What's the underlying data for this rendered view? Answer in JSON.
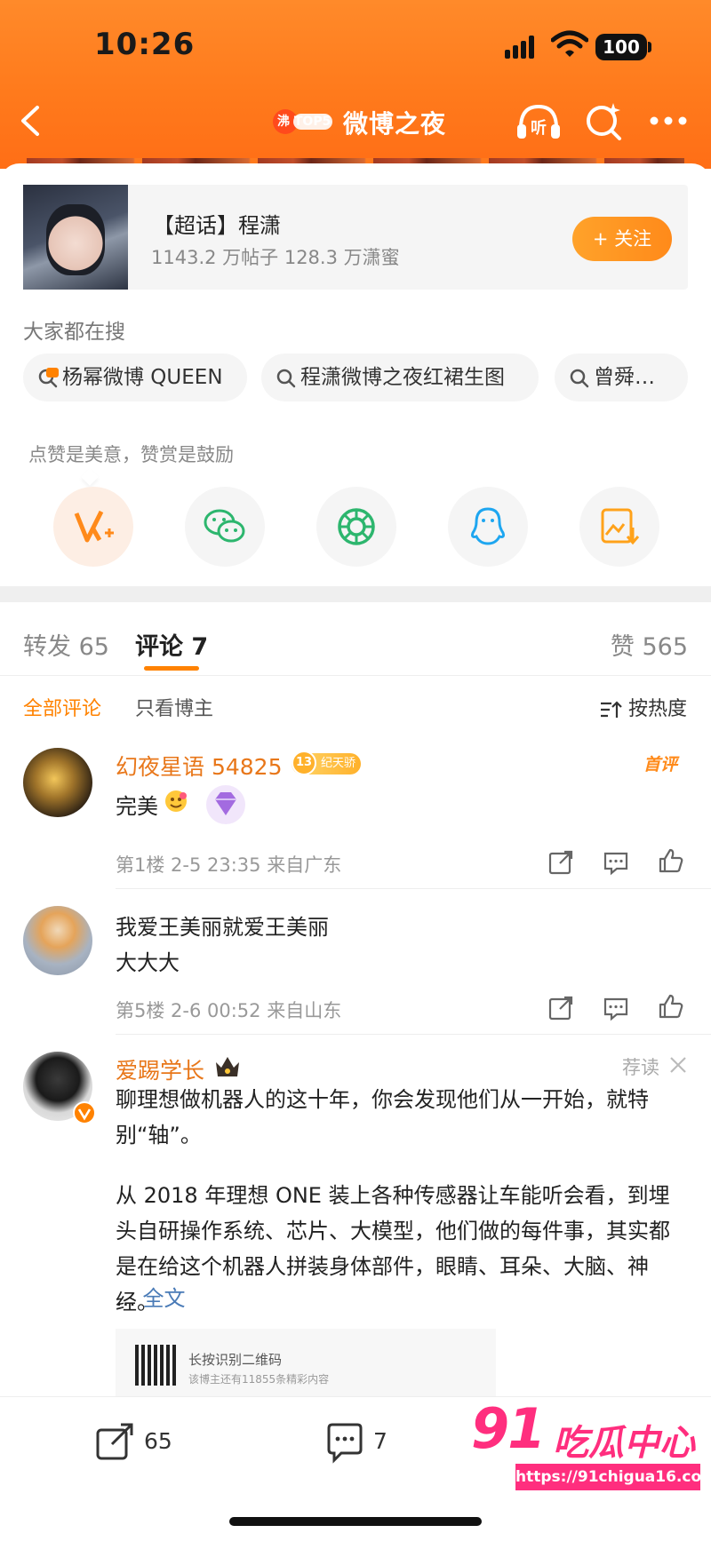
{
  "status_bar": {
    "time": "10:26",
    "battery": "100"
  },
  "nav": {
    "brand_badge": "沸 TOP5",
    "title": "微博之夜"
  },
  "topic": {
    "name": "【超话】程潇",
    "stats": "1143.2 万帖子 128.3 万潇蜜",
    "follow_label": "+ 关注"
  },
  "search": {
    "heading": "大家都在搜",
    "chips": [
      {
        "label": "杨幂微博 QUEEN",
        "icon": "hot-icon"
      },
      {
        "label": "程潇微博之夜红裙生图",
        "icon": "search-icon"
      },
      {
        "label": "曾舜…",
        "icon": "search-icon"
      }
    ]
  },
  "reward_tip": "点赞是美意，赞赏是鼓励",
  "share_targets": [
    "vplus-icon",
    "wechat-icon",
    "moments-icon",
    "qq-icon",
    "save-image-icon"
  ],
  "tabs": {
    "repost": "转发 65",
    "comment": "评论 7",
    "likes": "赞 565"
  },
  "filters": {
    "all": "全部评论",
    "author_only": "只看博主",
    "sort": "按热度"
  },
  "colors": {
    "accent": "#ff8200",
    "username": "#e8771a",
    "header": "#ff7a1c"
  },
  "comments": [
    {
      "user": "幻夜星语 54825",
      "level": "13",
      "badge": "纪天骄",
      "text": "完美",
      "tag": "首评",
      "meta": "第1楼 2-5 23:35 来自广东"
    },
    {
      "user": "我爱王美丽就爱王美丽",
      "text": "大大大",
      "meta": "第5楼 2-6 00:52 来自山东"
    }
  ],
  "promo": {
    "user": "爱踢学长",
    "recommend_label": "荐读",
    "para1": "聊理想做机器人的这十年，你会发现他们从一开始，就特别“轴”。",
    "para2": "从 2018 年理想 ONE 装上各种传感器让车能听会看，到埋头自研操作系统、芯片、大模型，他们做的每件事，其实都是在给这个机器人拼装身体部件，眼睛、耳朵、大脑、神经。",
    "more_prefix": "...",
    "more_link": "全文",
    "qr_title": "长按识别二维码",
    "qr_sub": "该博主还有11855条精彩内容"
  },
  "bottom_bar": {
    "repost_count": "65",
    "comment_count": "7"
  },
  "watermark": {
    "main": "91",
    "cn": "吃瓜中心",
    "url": "https://91chigua16.com"
  }
}
